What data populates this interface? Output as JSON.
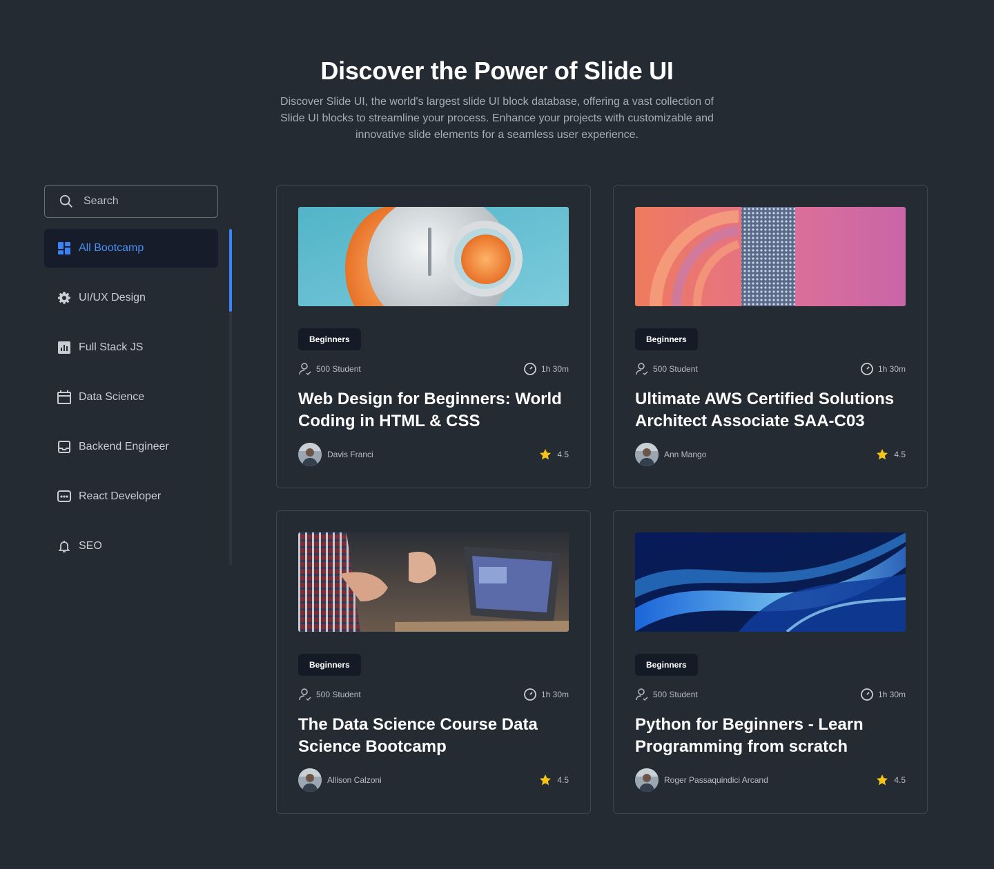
{
  "hero": {
    "title": "Discover the Power of Slide UI",
    "subtitle": "Discover Slide UI, the world's largest slide UI block database, offering a vast collection of Slide UI blocks to streamline your process. Enhance your projects with customizable and innovative slide elements for a seamless user experience."
  },
  "search": {
    "placeholder": "Search",
    "icon": "search-icon"
  },
  "sidebar": {
    "accent": "#3b82f6",
    "items": [
      {
        "label": "All Bootcamp",
        "icon": "grid-icon",
        "active": true
      },
      {
        "label": "UI/UX Design",
        "icon": "gear-icon",
        "active": false
      },
      {
        "label": "Full Stack JS",
        "icon": "chart-icon",
        "active": false
      },
      {
        "label": "Data Science",
        "icon": "calendar-icon",
        "active": false
      },
      {
        "label": "Backend Engineer",
        "icon": "inbox-icon",
        "active": false
      },
      {
        "label": "React Developer",
        "icon": "chat-icon",
        "active": false
      },
      {
        "label": "SEO",
        "icon": "bell-icon",
        "active": false
      }
    ]
  },
  "courses": [
    {
      "badge": "Beginners",
      "students": "500 Student",
      "duration": "1h 30m",
      "title": "Web Design for Beginners: World Coding in HTML & CSS",
      "author": "Davis Franci",
      "rating": "4.5",
      "image": "robot-image"
    },
    {
      "badge": "Beginners",
      "students": "500 Student",
      "duration": "1h 30m",
      "title": "Ultimate AWS Certified Solutions Architect Associate SAA-C03",
      "author": "Ann Mango",
      "rating": "4.5",
      "image": "abstract-pink-image"
    },
    {
      "badge": "Beginners",
      "students": "500 Student",
      "duration": "1h 30m",
      "title": "The Data Science Course Data Science Bootcamp",
      "author": "Allison Calzoni",
      "rating": "4.5",
      "image": "laptop-meeting-image"
    },
    {
      "badge": "Beginners",
      "students": "500 Student",
      "duration": "1h 30m",
      "title": "Python for Beginners - Learn Programming from scratch",
      "author": "Roger Passaquindici Arcand",
      "rating": "4.5",
      "image": "blue-waves-image"
    }
  ],
  "colors": {
    "background": "#252b33",
    "star": "#f5c518",
    "active_text": "#4a90f5"
  }
}
